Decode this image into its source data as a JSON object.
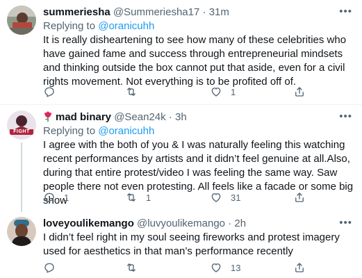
{
  "tweets": [
    {
      "name": "summeriesha",
      "handle": "@Summeriesha17",
      "separator": "·",
      "time": "31m",
      "replying_prefix": "Replying to",
      "replying_to": "@oranicuhh",
      "text": "It is really disheartening to see how many of these celebrities who have gained fame and success through entrepreneurial mindsets and thinking outside the box cannot put that aside, even for a civil rights movement. Not everything is to be profited off of.",
      "replies": "",
      "retweets": "",
      "likes": "1"
    },
    {
      "name": "mad binary",
      "name_emoji": "rose-emoji",
      "handle": "@Sean24k",
      "separator": "·",
      "time": "3h",
      "replying_prefix": "Replying to",
      "replying_to": "@oranicuhh",
      "avatar_text": "FIGHT",
      "text": "I agree with the both of you & I was naturally feeling this watching recent performances by artists and it didn’t feel genuine at all.Also, during that entire protest/video I was feeling the same way. Saw people there not even protesting. All feels like a facade or some big show",
      "replies": "1",
      "retweets": "1",
      "likes": "31"
    },
    {
      "name": "loveyoulikemango",
      "handle": "@luvyoulikemango",
      "separator": "·",
      "time": "2h",
      "text": "I didn’t feel right in my soul seeing fireworks and protest imagery used for aesthetics in that man’s performance recently",
      "replies": "",
      "retweets": "",
      "likes": "13"
    }
  ],
  "more_label": "•••",
  "colors": {
    "accent": "#1d9bf0",
    "secondary": "#536471",
    "separator": "#eff3f4"
  }
}
